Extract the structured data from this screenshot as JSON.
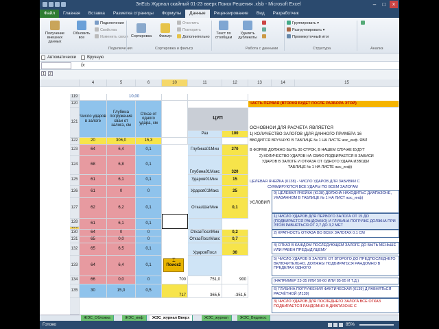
{
  "window": {
    "title": "ЗнЕсЬ Журнал скайный 01-23 вверх Поиск Решения .xlsb - Microsoft Excel"
  },
  "tabs": [
    "Файл",
    "Главная",
    "Вставка",
    "Разметка страницы",
    "Формулы",
    "Данные",
    "Рецензирование",
    "Вид",
    "Разработчик"
  ],
  "ribbon": {
    "get_data": "Получение внешних данных",
    "refresh": "Обновить все",
    "connections": "Подключения",
    "properties": "Свойства",
    "edit_links": "Изменить связи",
    "group_connections": "Подключения",
    "sort": "Сортировка",
    "filter": "Фильтр",
    "clear": "Очистить",
    "reapply": "Повторить",
    "advanced": "Дополнительно",
    "group_sort": "Сортировка и фильтр",
    "text_to_columns": "Текст по столбцам",
    "remove_dup": "Удалить дубликаты",
    "group_data": "Работа с данными",
    "group": "Группировать",
    "ungroup": "Разгруппировать",
    "subtotal": "Промежуточный итог",
    "group_outline": "Структура",
    "analysis": "Анализ"
  },
  "qbar": {
    "auto": "Автоматически",
    "manual": "Вручную"
  },
  "col_headers": [
    "4",
    "5",
    "6",
    "10",
    "11",
    "12",
    "13",
    "14",
    "15"
  ],
  "rows": {
    "r119": {
      "num": "119",
      "e": "10,00"
    },
    "r120": {
      "num": "120"
    },
    "r121": {
      "num": "121",
      "raz": "Раз",
      "raz_val": "100"
    },
    "r122": {
      "num": "122",
      "a": "20",
      "b": "306,0",
      "c": "15,3"
    },
    "headers": {
      "a": "Число ударов в залоге",
      "b": "Глубина погружения сваи от залога, см",
      "c": "Отказ от одного удара, см",
      "cup": "ЦУП"
    },
    "r123": {
      "num": "123",
      "a": "64",
      "b": "6,4",
      "c": "0,1",
      "lbl": "Глубина01Мин",
      "val": "270"
    },
    "r124": {
      "num": "124",
      "a": "68",
      "b": "6,8",
      "c": "0,1",
      "lbl": "Глубина01Макс",
      "val": "320"
    },
    "r125": {
      "num": "125",
      "a": "61",
      "b": "6,1",
      "c": "0,1",
      "lbl": "Ударов01Мин",
      "val": "15"
    },
    "r126": {
      "num": "126",
      "a": "61",
      "b": "0",
      "c": "0",
      "lbl": "Ударов01Макс",
      "val": "25"
    },
    "r127": {
      "num": "127",
      "a": "62",
      "b": "6,2",
      "c": "0,1",
      "lbl": "ОтказШагМин",
      "val": "0,1"
    },
    "r128": {
      "num": "128",
      "a": "61",
      "b": "6,1",
      "c": "0,1"
    },
    "r129": {
      "num": "129"
    },
    "r130": {
      "num": "130",
      "a": "64",
      "b": "0",
      "c": "0",
      "lbl": "ОтказПослМин",
      "val": "0,2"
    },
    "r131": {
      "num": "131",
      "a": "65",
      "b": "0,0",
      "c": "0",
      "lbl": "ОтказПослМакс",
      "val": "0,7"
    },
    "r132": {
      "num": "132",
      "a": "65",
      "b": "6,5",
      "c": "0,1",
      "lbl": "УдаровПосл",
      "val": "30"
    },
    "r133": {
      "num": "133",
      "a": "64",
      "b": "6,4",
      "c": "0,1"
    },
    "r134": {
      "num": "134",
      "a": "66",
      "b": "0,0",
      "c": "0",
      "d": "700",
      "e": "751,0",
      "f": "900"
    },
    "r135": {
      "num": "135",
      "a": "30",
      "b": "15,0",
      "c": "0,5",
      "d": "717",
      "e": "365,5",
      "f": "-351,5"
    }
  },
  "button": {
    "label": "Поиск2"
  },
  "notes": {
    "part1": "ЧАСТЬ ПЕРВАЯ (ВТОРАЯ БУДЕТ ПОСЛЕ РАЗБОРА ЭТОЙ)",
    "basic": "ОСНОВНОЙ ДЛЯ РАСЧЁТА ЯВЛЯЕТСЯ",
    "l1": "1) КОЛИЧЕСТВО ЗАЛОГОВ (ДЛЯ ДАННОГО ПРИМЕРА 16",
    "l2": "ВВОДИТСЯ ВРУЧНУЮ В ТАБЛИЦЕ № 1 НА ЛИСТЕ жэс_инф. ЯВЛ",
    "l3": "В ФОРМЕ ДОЛЖНО БЫТЬ 30 СТРОК, В НАШЕМ СЛУЧАЕ БУДУТ",
    "l4": "2) КОЛИЧЕСТВО УДАРОВ НА СВАЮ ПОДБИРАЕТСЯ В ЗАВИСИ",
    "l5": "УДАРОВ В ЗАЛОГЕ И ОТКАЗА ОТ ОДНОГО УДАРА ИЗВОДИ",
    "l6": "ТАБЛИЦЕ № 1 НА ЛИСТЕ жэс_инф)",
    "target": "ЦЕЛЕВАЯ ЯЧЕЙКА (К138) - ЧИСЛО УДАРОВ ДЛЯ ЗАБИВКИ С",
    "target2": "СУММИРУЮТСЯ ВСЕ УДАРЫ ПО ВСЕМ ЗАЛОГАМ",
    "cond": "УСЛОВИЯ",
    "c0": "0) ЦЕЛЕВАЯ ЯЧЕЙКА (К138) ДОЛЖНА НАХОДИТЬС ДИАПАЗОНЕ, УКАЗАННОМ В ТАБЛИЦЕ № 1 НА ЛИСТ жэс_инф)",
    "c1": "1) ЧИСЛО УДАРОВ ДЛЯ ПЕРВОГО ЗАЛОГА ОТ 15 ДО (ПОДБИРАЕТСЯ РАНДОМНО) И ГЛУБИНА ПОГРУЖЕ ДОЛЖНА ПРИ ЭТОМ РАВНЯТЬСЯ ОТ 2,7 ДО 3,2 МЕТ",
    "c2": "2) КРАТНОСТЬ ОТКАЗА ВО ВСЕХ ЗАЛОГАХ 0.1 СМ",
    "c3": "4) ОТКАЗ В КАЖДОМ ПОСЛЕДУЮЩЕМ ЗАЛОГЕ ДО БЫТЬ МЕНЬШЕ ИЛИ РАВЕН ПРЕДЫДУЩЕМУ",
    "c4": "5) ЧИСЛО УДАРОВ В ЗАЛОГЕ ОТ ВТОРОГО ДО ПРЕДПОСЛЕДНЕГО ВКЛЮЧИТЕЛЬНО, ДОЛЖНЫ ПОДБИРАТЬСЯ РАНДОМНО В ПРЕДЕЛАХ ОДНОГО",
    "c5": "(НАПРИМЕР 23-35 ИЛИ 50-60 ИЛИ 85-95 И Т.Д.)",
    "c6": "6) ГЛУБИНА ПОГРУЖЕНИЯ ФАКТИЧЕСКАЯ (К139) Д РАВНЯТЬСЯ РАСЧЁТНОЙ (Л139)",
    "c7": "3) ЧИСЛО УДАРОВ ДЛЯ ПОСЛЕДНЕГО ЗАЛОГА ВСЕ ОТКАЗ ПОДБИРАЕТСЯ РАНДОМНО В ДИАПАЗОНЕ С"
  },
  "sheets": [
    "ЖЭС_Обложка",
    "ЖЭС_инф",
    "ЖЭС_журнал Вверх",
    "ЖЭС_журнал",
    "ЖЭС_Ведомос"
  ],
  "status": {
    "ready": "Готово",
    "zoom": "85%"
  },
  "colors": {
    "accent": "#2b4a6e",
    "file_tab": "#2e7d32",
    "blue": "#8fc3ec",
    "pink": "#e79aa0",
    "yellow": "#f7e44a",
    "orange": "#f5b400"
  }
}
